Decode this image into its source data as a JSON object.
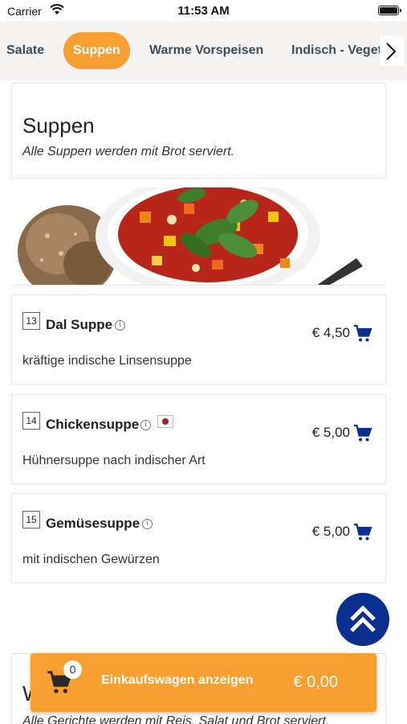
{
  "status_bar": {
    "carrier": "Carrier",
    "time": "11:53 AM"
  },
  "tabs": [
    {
      "label": "Salate"
    },
    {
      "label": "Suppen",
      "active": true
    },
    {
      "label": "Warme Vorspeisen"
    },
    {
      "label": "Indisch - Veget"
    }
  ],
  "section": {
    "title": "Suppen",
    "subtitle": "Alle Suppen werden mit Brot serviert."
  },
  "items": [
    {
      "number": "13",
      "name": "Dal Suppe",
      "price": "€ 4,50",
      "description": "kräftige indische Linsensuppe"
    },
    {
      "number": "14",
      "name": "Chickensuppe",
      "price": "€ 5,00",
      "description": "Hühnersuppe nach indischer Art",
      "badge": "non-veg-marker"
    },
    {
      "number": "15",
      "name": "Gemüsesuppe",
      "price": "€ 5,00",
      "description": "mit indischen Gewürzen"
    }
  ],
  "next_section": {
    "title": "W",
    "subtitle": "Alle Gerichte werden mit Reis, Salat und Brot serviert."
  },
  "cart": {
    "count": "0",
    "label": "Einkaufswagen anzeigen",
    "total": "€ 0,00"
  },
  "colors": {
    "accent": "#f7a031",
    "navy": "#0b2f8e",
    "tab_text": "#3c4e5c"
  },
  "icons": [
    "wifi-icon",
    "battery-icon",
    "chevron-right-icon",
    "info-icon",
    "cart-icon",
    "double-chevron-up-icon"
  ]
}
